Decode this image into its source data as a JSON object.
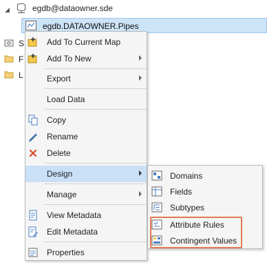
{
  "tree": {
    "root_label": "egdb@dataowner.sde",
    "root_icon": "database-connection-icon",
    "selected_label": "egdb.DATAOWNER.Pipes",
    "selected_icon": "feature-class-icon",
    "behind_items": [
      "S",
      "F",
      "L"
    ]
  },
  "menu": {
    "add_to_current_map": "Add To Current Map",
    "add_to_new": "Add To New",
    "export": "Export",
    "load_data": "Load Data",
    "copy": "Copy",
    "rename": "Rename",
    "delete": "Delete",
    "design": "Design",
    "manage": "Manage",
    "view_metadata": "View Metadata",
    "edit_metadata": "Edit Metadata",
    "properties": "Properties"
  },
  "submenu": {
    "domains": "Domains",
    "fields": "Fields",
    "subtypes": "Subtypes",
    "attribute_rules": "Attribute Rules",
    "contingent_values": "Contingent Values"
  },
  "colors": {
    "selection": "#cde4f7",
    "highlight": "#c9e0f7",
    "callout": "#e07b52",
    "delete_x": "#d9472b",
    "add_yellow": "#f2c94c"
  }
}
